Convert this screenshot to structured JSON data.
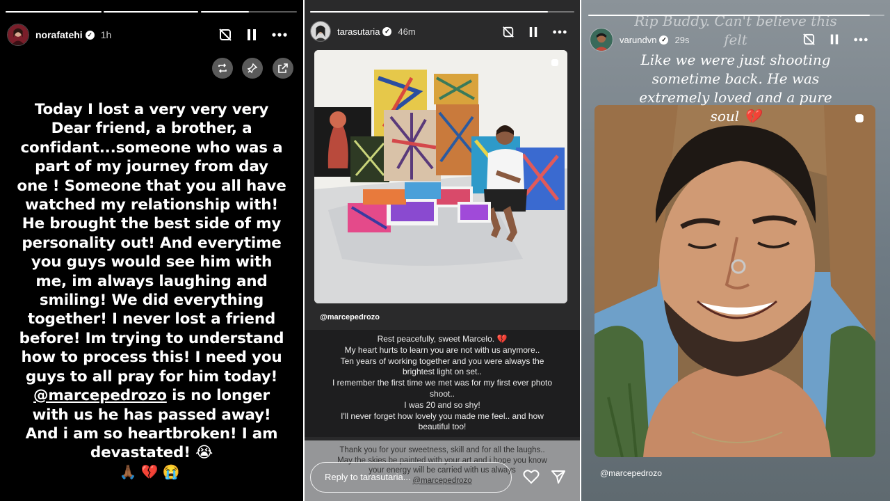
{
  "story1": {
    "username": "norafatehi",
    "time": "1h",
    "progress": [
      1.0,
      1.0,
      0.5
    ],
    "lines": [
      "Today I lost a very very very",
      "Dear friend, a brother, a",
      "confidant...someone who was a",
      "part of my journey from day",
      "one ! Someone that you all have",
      "watched my relationship with!",
      "He brought the best side of my",
      "personality out! And everytime",
      "you guys would see him with",
      "me, im always laughing and",
      "smiling! We did everything",
      "together! I never lost a friend",
      "before! Im trying to understand",
      "how to process this! I need you",
      "guys to all pray for him today!"
    ],
    "mention": "@marcepedrozo",
    "after_mention": " is no longer",
    "lines_end": [
      "with us he has passed away!",
      "And i am so heartbroken! I am",
      "devastated! 😭"
    ],
    "emojis": "🙏🏾💔😭",
    "icons": [
      "mute-icon",
      "pause-icon",
      "more-icon",
      "repost-icon",
      "pin-icon",
      "share-out-icon"
    ]
  },
  "story2": {
    "username": "tarasutaria",
    "time": "46m",
    "progress": [
      0.9
    ],
    "photo_tag": "@marcepedrozo",
    "caption": [
      "Rest peacefully, sweet Marcelo. 💔",
      "My heart hurts to learn you are not with us anymore..",
      "Ten years of working together and you were always the",
      "brightest light on set..",
      "I remember the first time we met was for my first ever photo",
      "shoot..",
      "I was 20 and so shy!",
      "I'll never forget how lovely you made me feel.. and how",
      "beautiful too!"
    ],
    "lower_caption": [
      "Thank you for your sweetness, skill and for all the laughs..",
      "May the skies be painted with your art and i hope you know",
      "your energy will be carried with us always"
    ],
    "lower_mention": "@marcepedrozo",
    "reply_placeholder": "Reply to tarasutaria...",
    "icons": [
      "mute-icon",
      "pause-icon",
      "more-icon",
      "heart-icon",
      "send-icon"
    ]
  },
  "story3": {
    "username": "varundvn",
    "time": "29s",
    "progress": [
      0.95
    ],
    "overlay_lines": [
      "Rip Buddy. Can't believe this",
      "felt",
      "Like we were just shooting",
      "sometime back. He was",
      "extremely loved and a pure",
      "soul 💔"
    ],
    "photo_tag": "@marcepedrozo",
    "icons": [
      "mute-icon",
      "pause-icon",
      "more-icon"
    ]
  },
  "colors": {
    "panel1_bg": "#000000",
    "panel2_bg": "#2a2a2b",
    "panel3_bg": "#6e7b86",
    "text": "#ffffff"
  }
}
